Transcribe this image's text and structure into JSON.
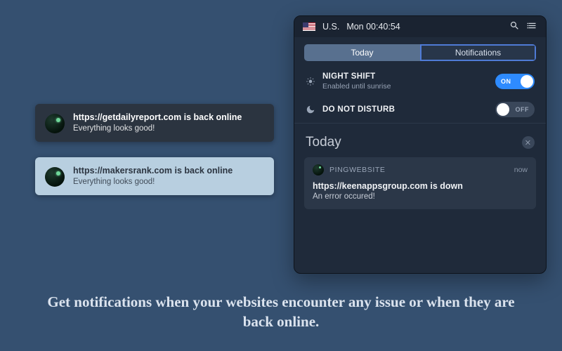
{
  "leftNotifs": [
    {
      "title": "https://getdailyreport.com is back online",
      "subtitle": "Everything looks good!",
      "theme": "dark"
    },
    {
      "title": "https://makersrank.com is back online",
      "subtitle": "Everything looks good!",
      "theme": "light"
    }
  ],
  "panel": {
    "menubar": {
      "locale": "U.S.",
      "datetime": "Mon 00:40:54"
    },
    "segments": {
      "today": "Today",
      "notifications": "Notifications",
      "active": "today",
      "outlined": "notifications"
    },
    "nightShift": {
      "title": "NIGHT SHIFT",
      "subtitle": "Enabled until sunrise",
      "value": "ON"
    },
    "dnd": {
      "title": "DO NOT DISTURB",
      "value": "OFF"
    },
    "sectionTitle": "Today",
    "widget": {
      "appName": "PINGWEBSITE",
      "time": "now",
      "title": "https://keenappsgroup.com is down",
      "subtitle": "An error occured!"
    }
  },
  "tagline": "Get notifications when your websites encounter any issue or when they are back online."
}
